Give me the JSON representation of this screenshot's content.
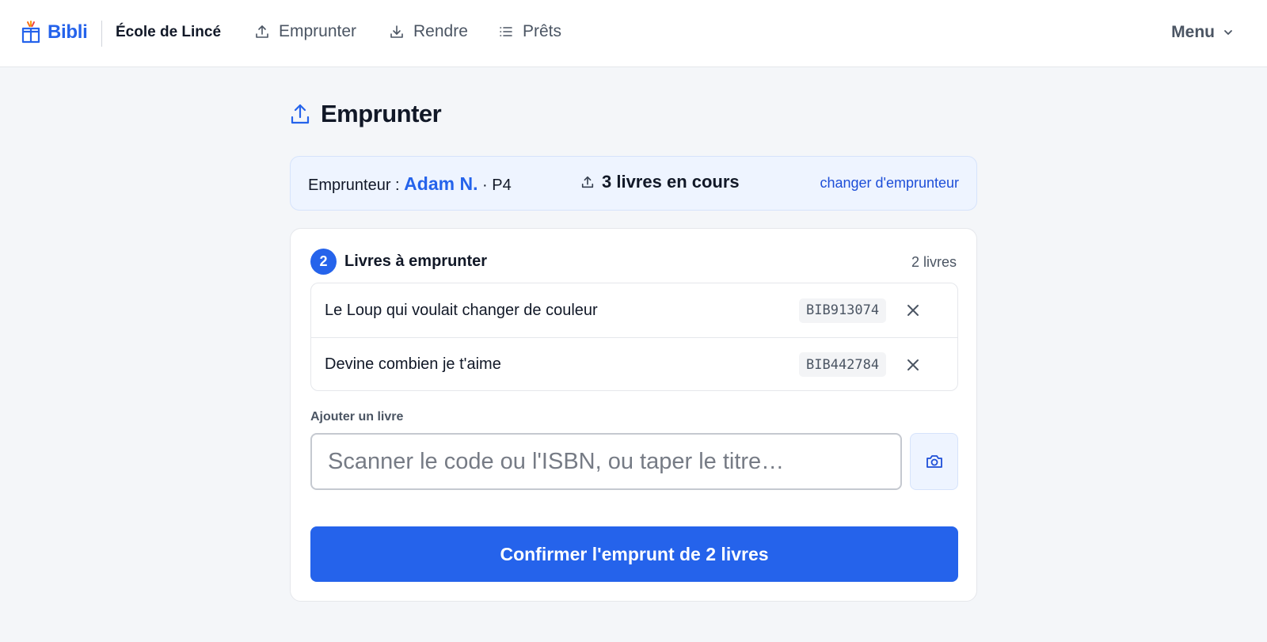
{
  "app": {
    "brand": "Bibli",
    "school": "École de Lincé",
    "accent_color": "#2563eb"
  },
  "nav": {
    "items": [
      {
        "label": "Emprunter",
        "icon": "upload-icon"
      },
      {
        "label": "Rendre",
        "icon": "download-icon"
      },
      {
        "label": "Prêts",
        "icon": "list-icon"
      }
    ],
    "menu_label": "Menu"
  },
  "page": {
    "title": "Emprunter",
    "title_icon": "upload-icon"
  },
  "borrower": {
    "prefix": "Emprunteur : ",
    "name": "Adam N.",
    "class_suffix": " · P4",
    "loans_in_progress": "3 livres en cours",
    "change_link": "changer d'emprunteur"
  },
  "books_section": {
    "step_number": "2",
    "title": "Livres à emprunter",
    "count_label": "2 livres",
    "books": [
      {
        "title": "Le Loup qui voulait changer de couleur",
        "code": "BIB913074"
      },
      {
        "title": "Devine combien je t'aime",
        "code": "BIB442784"
      }
    ]
  },
  "add_book": {
    "label": "Ajouter un livre",
    "value": "",
    "placeholder": "Scanner le code ou l'ISBN, ou taper le titre…",
    "camera_icon": "camera-icon"
  },
  "confirm": {
    "label": "Confirmer l'emprunt de 2 livres"
  }
}
